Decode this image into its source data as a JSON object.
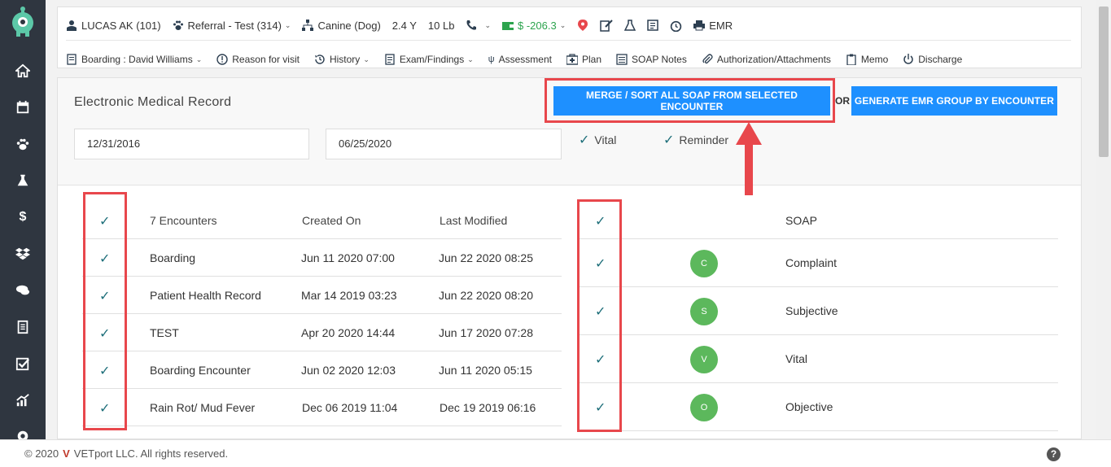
{
  "header": {
    "patient_name": "LUCAS AK (101)",
    "referral": "Referral - Test (314)",
    "species": "Canine (Dog)",
    "age": "2.4 Y",
    "weight": "10 Lb",
    "balance": "$ -206.3",
    "emr_label": "EMR"
  },
  "toolbar": {
    "encounter": "Boarding : David Williams",
    "reason": "Reason for visit",
    "history": "History",
    "exam": "Exam/Findings",
    "assessment": "Assessment",
    "plan": "Plan",
    "soap_notes": "SOAP Notes",
    "authorization": "Authorization/Attachments",
    "memo": "Memo",
    "discharge": "Discharge"
  },
  "page": {
    "title": "Electronic Medical Record",
    "start_date": "12/31/2016",
    "end_date": "06/25/2020",
    "vital_label": "Vital",
    "reminder_label": "Reminder",
    "merge_button": "MERGE / SORT ALL SOAP FROM SELECTED ENCOUNTER",
    "or_text": "OR",
    "generate_button": "GENERATE EMR GROUP BY ENCOUNTER"
  },
  "encounters": {
    "headers": [
      "7 Encounters",
      "Created On",
      "Last Modified"
    ],
    "rows": [
      {
        "name": "Boarding",
        "created": "Jun 11 2020 07:00",
        "modified": "Jun 22 2020 08:25"
      },
      {
        "name": "Patient Health Record",
        "created": "Mar 14 2019 03:23",
        "modified": "Jun 22 2020 08:20"
      },
      {
        "name": "TEST",
        "created": "Apr 20 2020 14:44",
        "modified": "Jun 17 2020 07:28"
      },
      {
        "name": "Boarding Encounter",
        "created": "Jun 02 2020 12:03",
        "modified": "Jun 11 2020 05:15"
      },
      {
        "name": "Rain Rot/ Mud Fever",
        "created": "Dec 06 2019 11:04",
        "modified": "Dec 19 2019 06:16"
      }
    ]
  },
  "soap": {
    "header": "SOAP",
    "rows": [
      {
        "badge": "C",
        "label": "Complaint"
      },
      {
        "badge": "S",
        "label": "Subjective"
      },
      {
        "badge": "V",
        "label": "Vital"
      },
      {
        "badge": "O",
        "label": "Objective"
      }
    ]
  },
  "footer": {
    "year": "© 2020",
    "brand_mark": "V",
    "company": "VETport LLC. All rights reserved.",
    "help": "?"
  },
  "colors": {
    "sidebar": "#2f3640",
    "primary_button": "#1e90ff",
    "check": "#1e6f7a",
    "badge": "#5cb85c",
    "highlight": "#e8474c",
    "balance": "#2da44e"
  }
}
